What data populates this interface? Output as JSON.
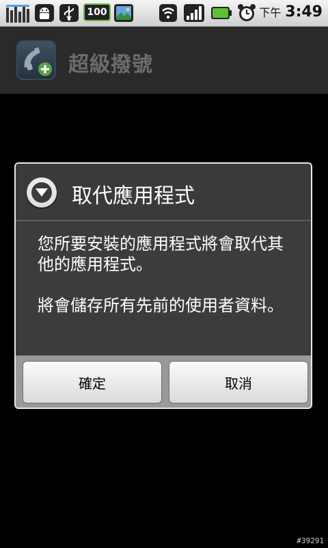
{
  "status_bar": {
    "icons": [
      "signal-bars-icon",
      "android-icon",
      "usb-icon",
      "battery-100-icon",
      "gallery-icon",
      "wifi-icon",
      "cell-signal-icon",
      "battery-icon",
      "alarm-icon"
    ],
    "battery_level_label": "100",
    "ampm": "下午",
    "time": "3:49"
  },
  "app_bar": {
    "title": "超級撥號",
    "icon": "phone-add-icon"
  },
  "dialog": {
    "title": "取代應用程式",
    "icon": "down-arrow-circle-icon",
    "message_1": "您所要安裝的應用程式將會取代其他的應用程式。",
    "message_2": "將會儲存所有先前的使用者資料。",
    "ok_label": "確定",
    "cancel_label": "取消"
  },
  "watermark": "#39291"
}
